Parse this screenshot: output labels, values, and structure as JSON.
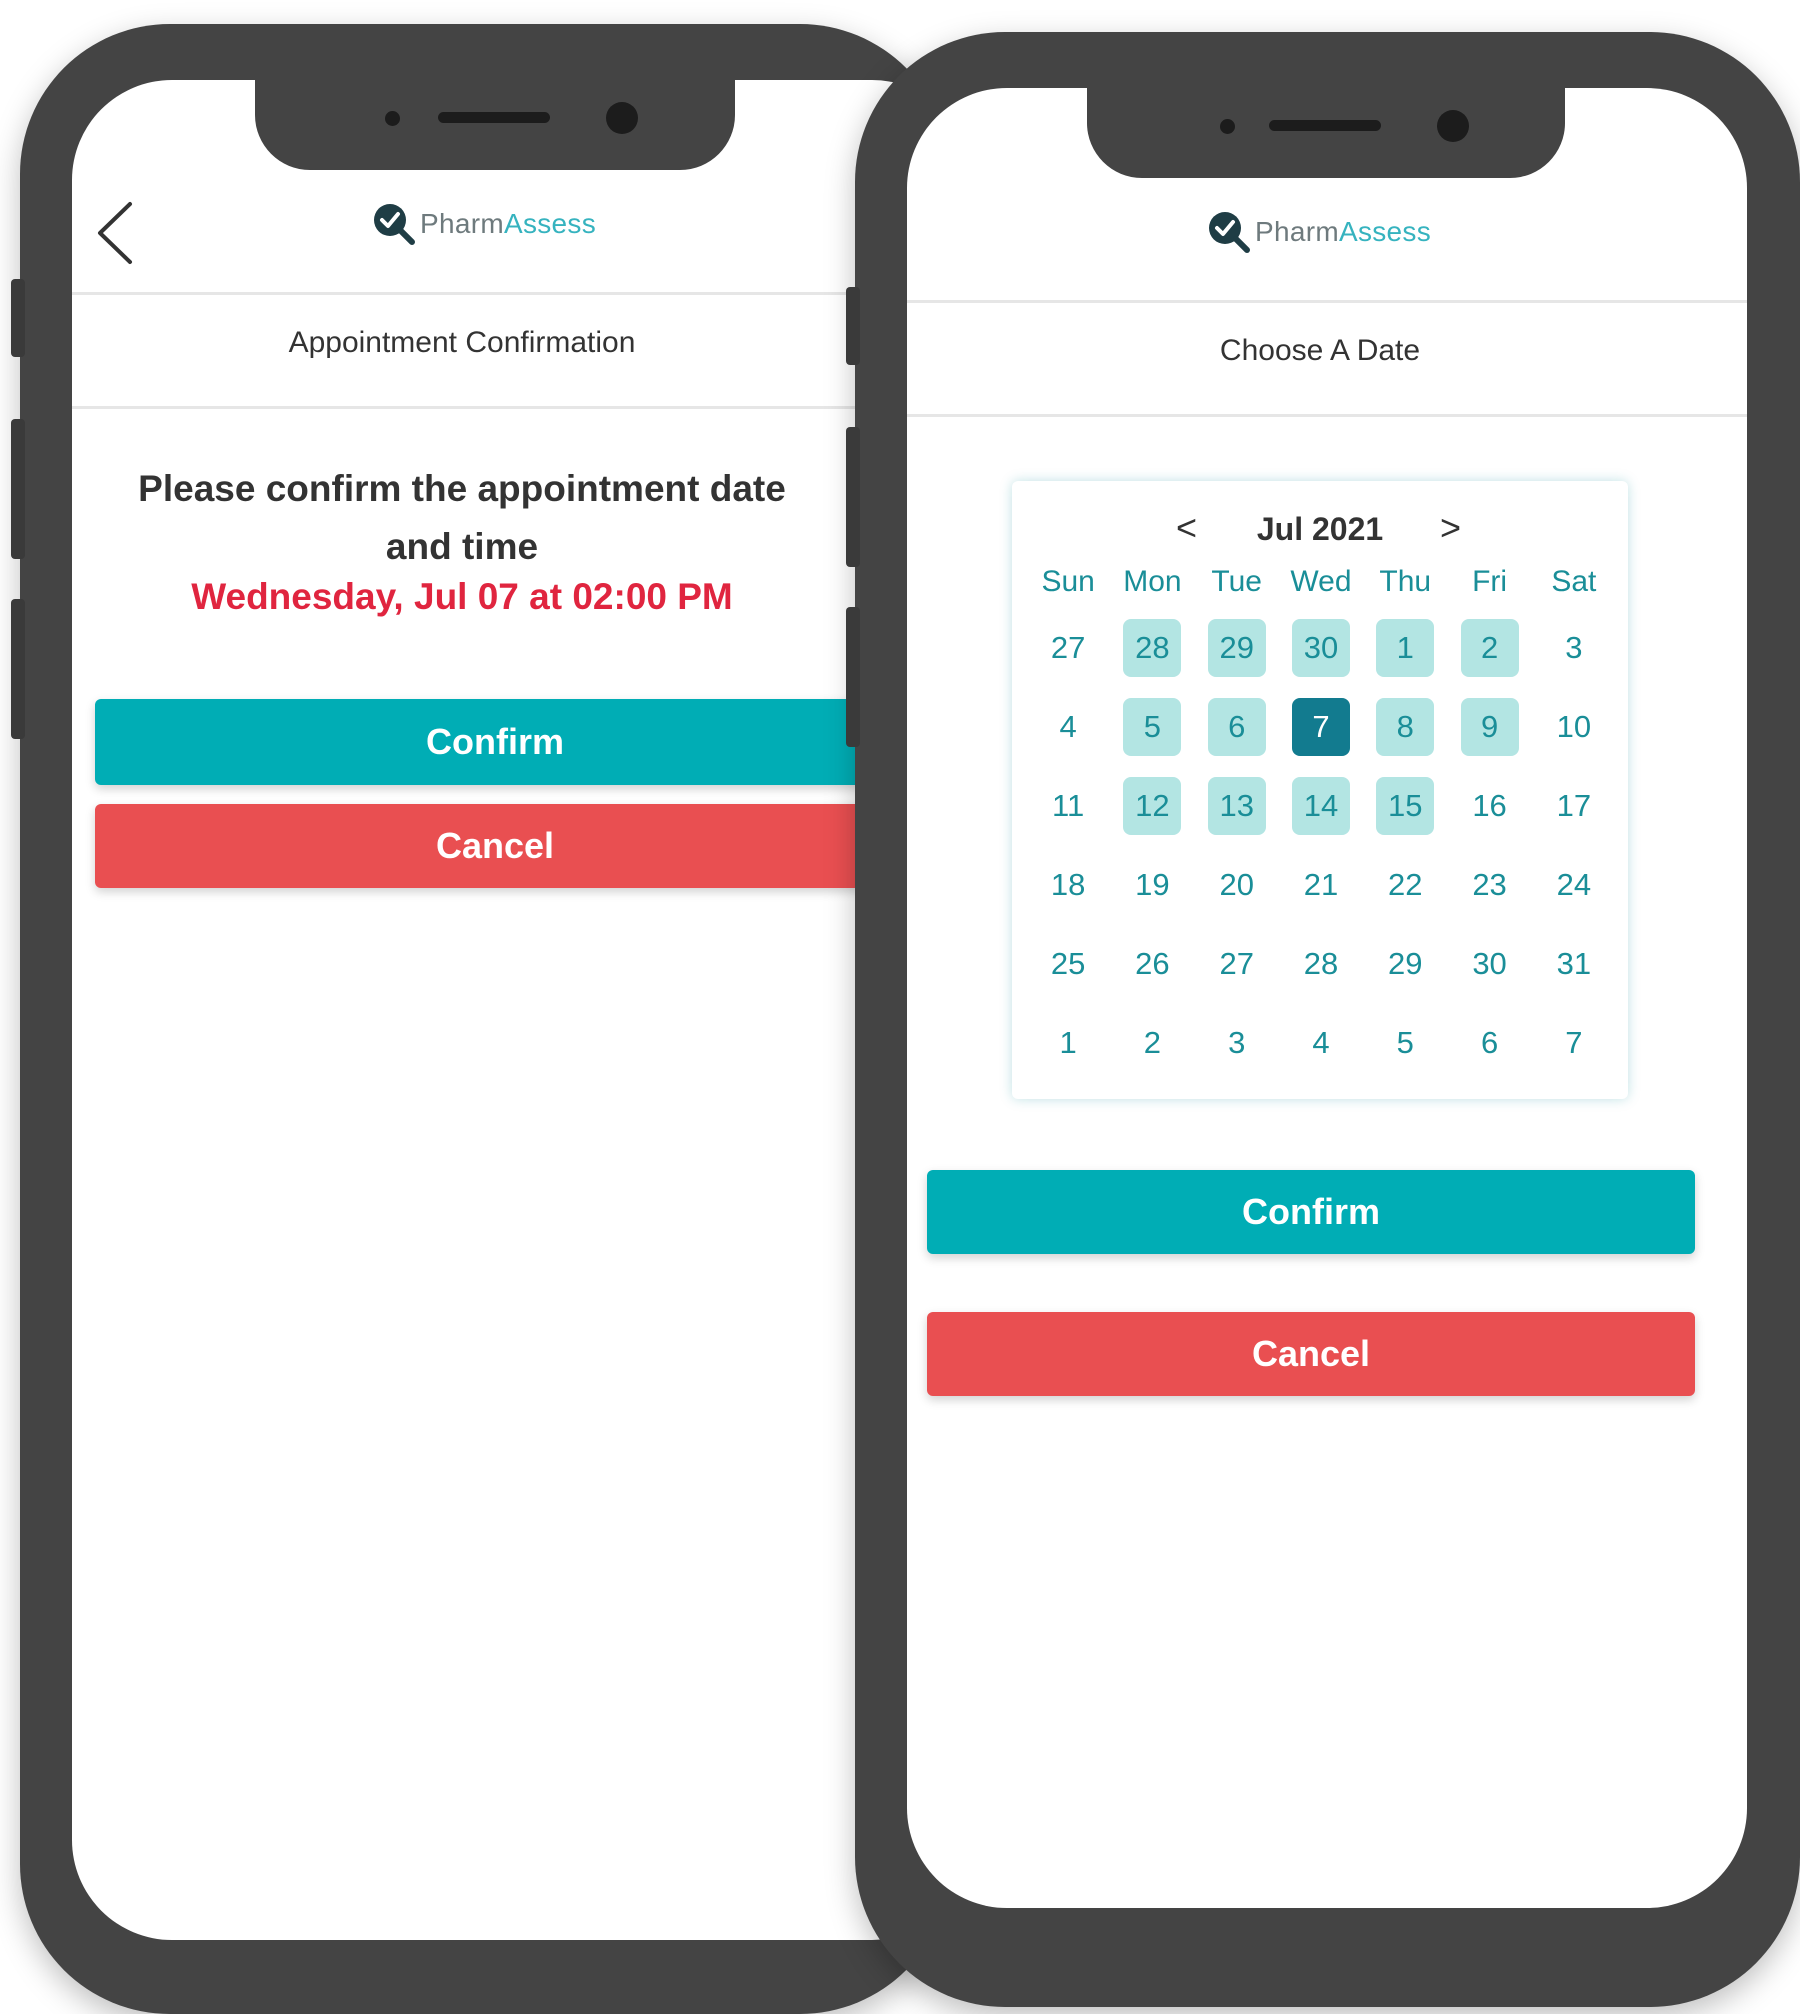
{
  "brand": {
    "name_part1": "Pharm",
    "name_part2": "Assess",
    "accent_color": "#36b3bf",
    "confirm_color": "#00adb5",
    "cancel_color": "#e94f51",
    "alert_text_color": "#e0253f"
  },
  "left_screen": {
    "title": "Appointment Confirmation",
    "message": "Please confirm the appointment date and time",
    "appointment_datetime": "Wednesday, Jul 07 at 02:00 PM",
    "confirm_label": "Confirm",
    "cancel_label": "Cancel"
  },
  "right_screen": {
    "title": "Choose A Date",
    "calendar": {
      "prev": "<",
      "next": ">",
      "month_label": "Jul 2021",
      "weekdays": [
        "Sun",
        "Mon",
        "Tue",
        "Wed",
        "Thu",
        "Fri",
        "Sat"
      ],
      "days": [
        {
          "d": "27",
          "s": "none"
        },
        {
          "d": "28",
          "s": "available"
        },
        {
          "d": "29",
          "s": "available"
        },
        {
          "d": "30",
          "s": "available"
        },
        {
          "d": "1",
          "s": "available"
        },
        {
          "d": "2",
          "s": "available"
        },
        {
          "d": "3",
          "s": "none"
        },
        {
          "d": "4",
          "s": "none"
        },
        {
          "d": "5",
          "s": "available"
        },
        {
          "d": "6",
          "s": "available"
        },
        {
          "d": "7",
          "s": "selected"
        },
        {
          "d": "8",
          "s": "available"
        },
        {
          "d": "9",
          "s": "available"
        },
        {
          "d": "10",
          "s": "none"
        },
        {
          "d": "11",
          "s": "none"
        },
        {
          "d": "12",
          "s": "available"
        },
        {
          "d": "13",
          "s": "available"
        },
        {
          "d": "14",
          "s": "available"
        },
        {
          "d": "15",
          "s": "available"
        },
        {
          "d": "16",
          "s": "none"
        },
        {
          "d": "17",
          "s": "none"
        },
        {
          "d": "18",
          "s": "none"
        },
        {
          "d": "19",
          "s": "none"
        },
        {
          "d": "20",
          "s": "none"
        },
        {
          "d": "21",
          "s": "none"
        },
        {
          "d": "22",
          "s": "none"
        },
        {
          "d": "23",
          "s": "none"
        },
        {
          "d": "24",
          "s": "none"
        },
        {
          "d": "25",
          "s": "none"
        },
        {
          "d": "26",
          "s": "none"
        },
        {
          "d": "27",
          "s": "none"
        },
        {
          "d": "28",
          "s": "none"
        },
        {
          "d": "29",
          "s": "none"
        },
        {
          "d": "30",
          "s": "none"
        },
        {
          "d": "31",
          "s": "none"
        },
        {
          "d": "1",
          "s": "none"
        },
        {
          "d": "2",
          "s": "none"
        },
        {
          "d": "3",
          "s": "none"
        },
        {
          "d": "4",
          "s": "none"
        },
        {
          "d": "5",
          "s": "none"
        },
        {
          "d": "6",
          "s": "none"
        },
        {
          "d": "7",
          "s": "none"
        }
      ]
    },
    "confirm_label": "Confirm",
    "cancel_label": "Cancel"
  }
}
